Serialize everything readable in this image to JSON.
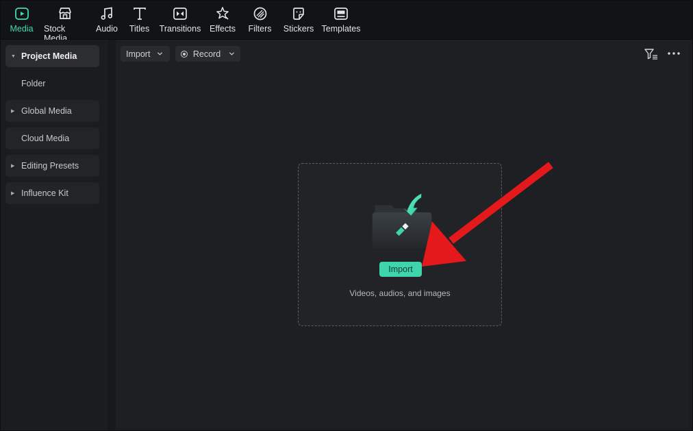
{
  "tabs": [
    {
      "label": "Media",
      "icon": "media-icon",
      "active": true
    },
    {
      "label": "Stock Media",
      "icon": "stock-media-icon",
      "active": false
    },
    {
      "label": "Audio",
      "icon": "music-note-icon",
      "active": false
    },
    {
      "label": "Titles",
      "icon": "title-t-icon",
      "active": false
    },
    {
      "label": "Transitions",
      "icon": "transitions-icon",
      "active": false
    },
    {
      "label": "Effects",
      "icon": "effects-icon",
      "active": false
    },
    {
      "label": "Filters",
      "icon": "filters-icon",
      "active": false
    },
    {
      "label": "Stickers",
      "icon": "stickers-icon",
      "active": false
    },
    {
      "label": "Templates",
      "icon": "templates-icon",
      "active": false
    }
  ],
  "sidebar": {
    "items": [
      {
        "label": "Project Media",
        "caret": "▼",
        "style": "active"
      },
      {
        "label": "Folder",
        "caret": "",
        "style": "plain"
      },
      {
        "label": "Global Media",
        "caret": "▶",
        "style": "boxed"
      },
      {
        "label": "Cloud Media",
        "caret": "",
        "style": "boxed"
      },
      {
        "label": "Editing Presets",
        "caret": "▶",
        "style": "boxed"
      },
      {
        "label": "Influence Kit",
        "caret": "▶",
        "style": "boxed"
      }
    ]
  },
  "toolbar": {
    "import_label": "Import",
    "record_label": "Record",
    "filter_icon": "filter-icon",
    "more_icon": "more-dots-icon"
  },
  "dropzone": {
    "button_label": "Import",
    "caption": "Videos, audios, and images",
    "illustration": "folder-import-icon"
  },
  "colors": {
    "accent": "#3ed5ad",
    "annotation_arrow": "#e3191c",
    "background": "#1e1f22"
  }
}
